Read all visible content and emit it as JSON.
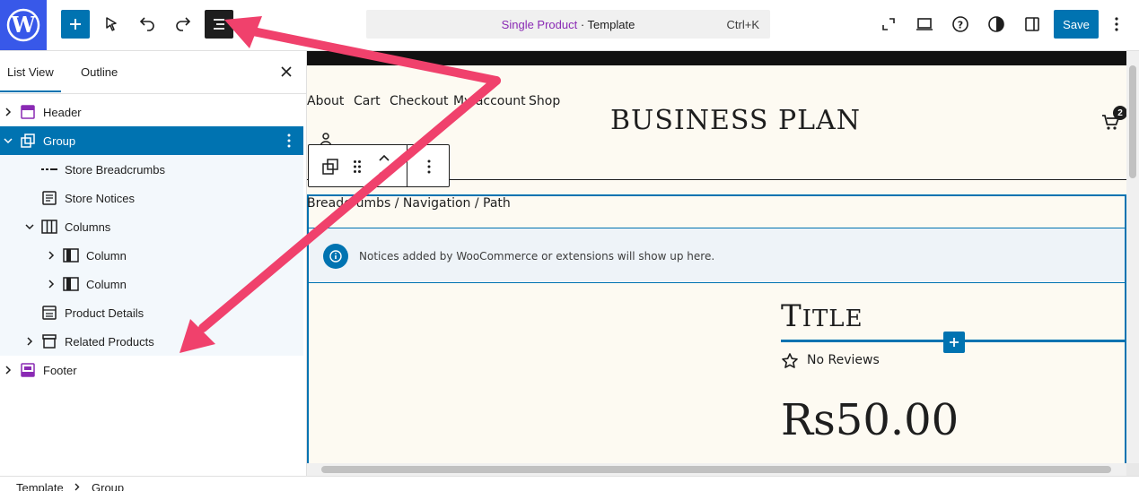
{
  "toolbar": {
    "command_title_highlight": "Single Product",
    "command_title_rest": " · Template",
    "command_shortcut": "Ctrl+K",
    "save_label": "Save"
  },
  "sidebar": {
    "tabs": [
      {
        "label": "List View",
        "active": true
      },
      {
        "label": "Outline",
        "active": false
      }
    ],
    "tree": [
      {
        "label": "Header",
        "icon": "header-template-icon"
      },
      {
        "label": "Group",
        "icon": "group-icon",
        "selected": true
      },
      {
        "label": "Store Breadcrumbs",
        "icon": "breadcrumbs-icon"
      },
      {
        "label": "Store Notices",
        "icon": "notices-icon"
      },
      {
        "label": "Columns",
        "icon": "columns-icon"
      },
      {
        "label": "Column",
        "icon": "column-icon"
      },
      {
        "label": "Column",
        "icon": "column-icon"
      },
      {
        "label": "Product Details",
        "icon": "product-details-icon"
      },
      {
        "label": "Related Products",
        "icon": "related-products-icon"
      },
      {
        "label": "Footer",
        "icon": "footer-template-icon"
      }
    ]
  },
  "canvas": {
    "nav": [
      "About",
      "Cart",
      "Checkout",
      "My account",
      "Shop"
    ],
    "brand": "BUSINESS PLAN",
    "cart_count": "2",
    "breadcrumbs": "Breadcrumbs / Navigation / Path",
    "notice": "Notices added by WooCommerce or extensions will show up here.",
    "product_title_first": "T",
    "product_title_rest": "ITLE",
    "reviews": "No Reviews",
    "price": "Rs50.00"
  },
  "footer_breadcrumb": [
    "Template",
    "Group"
  ],
  "colors": {
    "wp_blue": "#3858e9",
    "accent": "#0073b1",
    "annotation_arrow": "#f0416c"
  }
}
